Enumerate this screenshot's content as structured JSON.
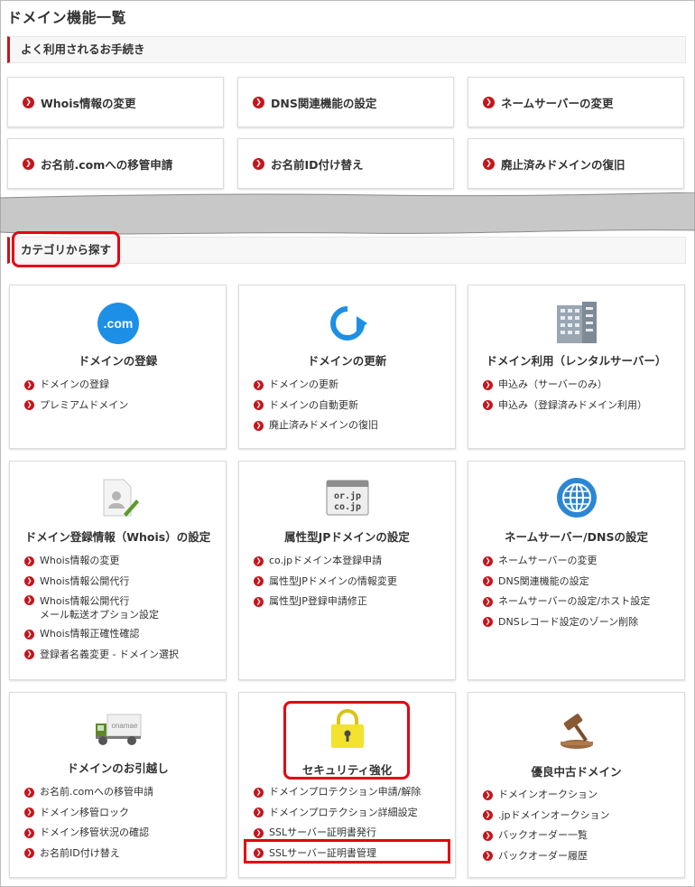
{
  "page": {
    "title": "ドメイン機能一覧"
  },
  "quick": {
    "heading": "よく利用されるお手続き",
    "items": [
      "Whois情報の変更",
      "DNS関連機能の設定",
      "ネームサーバーの変更",
      "お名前.comへの移管申請",
      "お名前ID付け替え",
      "廃止済みドメインの復旧"
    ]
  },
  "category": {
    "heading": "カテゴリから探す",
    "cards": [
      {
        "title": "ドメインの登録",
        "icon": "com-icon",
        "links": [
          "ドメインの登録",
          "プレミアムドメイン"
        ]
      },
      {
        "title": "ドメインの更新",
        "icon": "renew-arrow-icon",
        "links": [
          "ドメインの更新",
          "ドメインの自動更新",
          "廃止済みドメインの復旧"
        ]
      },
      {
        "title": "ドメイン利用（レンタルサーバー）",
        "icon": "server-rack-icon",
        "links": [
          "申込み（サーバーのみ）",
          "申込み（登録済みドメイン利用）"
        ]
      },
      {
        "title": "ドメイン登録情報（Whois）の設定",
        "icon": "profile-edit-icon",
        "links": [
          "Whois情報の変更",
          "Whois情報公開代行",
          "Whois情報公開代行|メール転送オプション設定",
          "Whois情報正確性確認",
          "登録者名義変更 - ドメイン選択"
        ]
      },
      {
        "title": "属性型JPドメインの設定",
        "icon": "jp-domain-icon",
        "icon_text": [
          "or.jp",
          "co.jp"
        ],
        "links": [
          "co.jpドメイン本登録申請",
          "属性型JPドメインの情報変更",
          "属性型JP登録申請修正"
        ]
      },
      {
        "title": "ネームサーバー/DNSの設定",
        "icon": "globe-icon",
        "links": [
          "ネームサーバーの変更",
          "DNS関連機能の設定",
          "ネームサーバーの設定/ホスト設定",
          "DNSレコード設定のゾーン削除"
        ]
      },
      {
        "title": "ドメインのお引越し",
        "icon": "truck-icon",
        "icon_text": [
          "onamae"
        ],
        "links": [
          "お名前.comへの移管申請",
          "ドメイン移管ロック",
          "ドメイン移管状況の確認",
          "お名前ID付け替え"
        ]
      },
      {
        "title": "セキュリティ強化",
        "icon": "padlock-icon",
        "links": [
          "ドメインプロテクション申請/解除",
          "ドメインプロテクション詳細設定",
          "SSLサーバー証明書発行",
          "SSLサーバー証明書管理"
        ]
      },
      {
        "title": "優良中古ドメイン",
        "icon": "gavel-icon",
        "links": [
          "ドメインオークション",
          ".jpドメインオークション",
          "バックオーダー一覧",
          "バックオーダー履歴"
        ]
      }
    ]
  },
  "colors": {
    "accent": "#c4161c",
    "highlight": "#e60012",
    "com_blue": "#1d8fe6",
    "globe_blue": "#2b86d6",
    "lock_yellow": "#f3e22e"
  }
}
